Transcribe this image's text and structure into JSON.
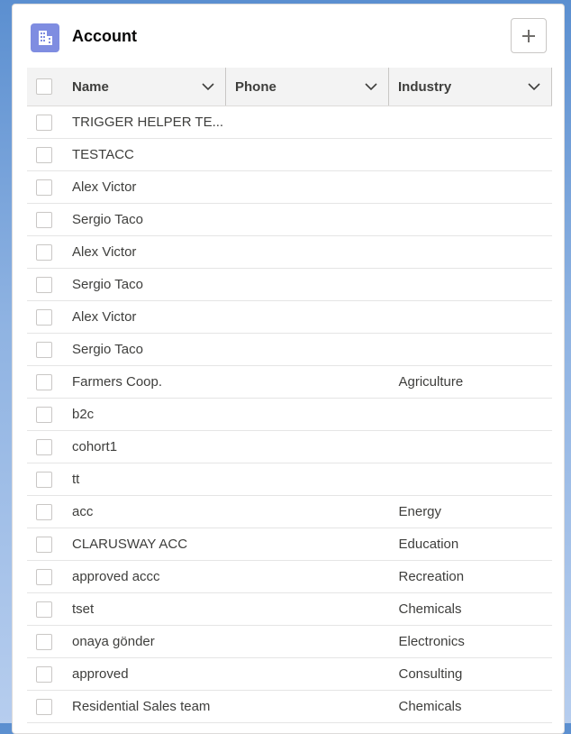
{
  "header": {
    "title": "Account",
    "icon": "account-building-icon",
    "add_icon": "plus-icon"
  },
  "columns": [
    {
      "label": "Name"
    },
    {
      "label": "Phone"
    },
    {
      "label": "Industry"
    }
  ],
  "rows": [
    {
      "name": "TRIGGER HELPER TE...",
      "phone": "",
      "industry": ""
    },
    {
      "name": "TESTACC",
      "phone": "",
      "industry": ""
    },
    {
      "name": "Alex Victor",
      "phone": "",
      "industry": ""
    },
    {
      "name": "Sergio Taco",
      "phone": "",
      "industry": ""
    },
    {
      "name": "Alex Victor",
      "phone": "",
      "industry": ""
    },
    {
      "name": "Sergio Taco",
      "phone": "",
      "industry": ""
    },
    {
      "name": "Alex Victor",
      "phone": "",
      "industry": ""
    },
    {
      "name": "Sergio Taco",
      "phone": "",
      "industry": ""
    },
    {
      "name": "Farmers Coop.",
      "phone": "",
      "industry": "Agriculture"
    },
    {
      "name": "b2c",
      "phone": "",
      "industry": ""
    },
    {
      "name": "cohort1",
      "phone": "",
      "industry": ""
    },
    {
      "name": "tt",
      "phone": "",
      "industry": ""
    },
    {
      "name": "acc",
      "phone": "",
      "industry": "Energy"
    },
    {
      "name": "CLARUSWAY ACC",
      "phone": "",
      "industry": "Education"
    },
    {
      "name": "approved accc",
      "phone": "",
      "industry": "Recreation"
    },
    {
      "name": "tset",
      "phone": "",
      "industry": "Chemicals"
    },
    {
      "name": "onaya gönder",
      "phone": "",
      "industry": "Electronics"
    },
    {
      "name": "approved",
      "phone": "",
      "industry": "Consulting"
    },
    {
      "name": "Residential Sales team",
      "phone": "",
      "industry": "Chemicals"
    }
  ],
  "colors": {
    "icon_bg": "#7f8de1",
    "header_bg": "#f3f3f3",
    "background": "#8fb3e2"
  }
}
